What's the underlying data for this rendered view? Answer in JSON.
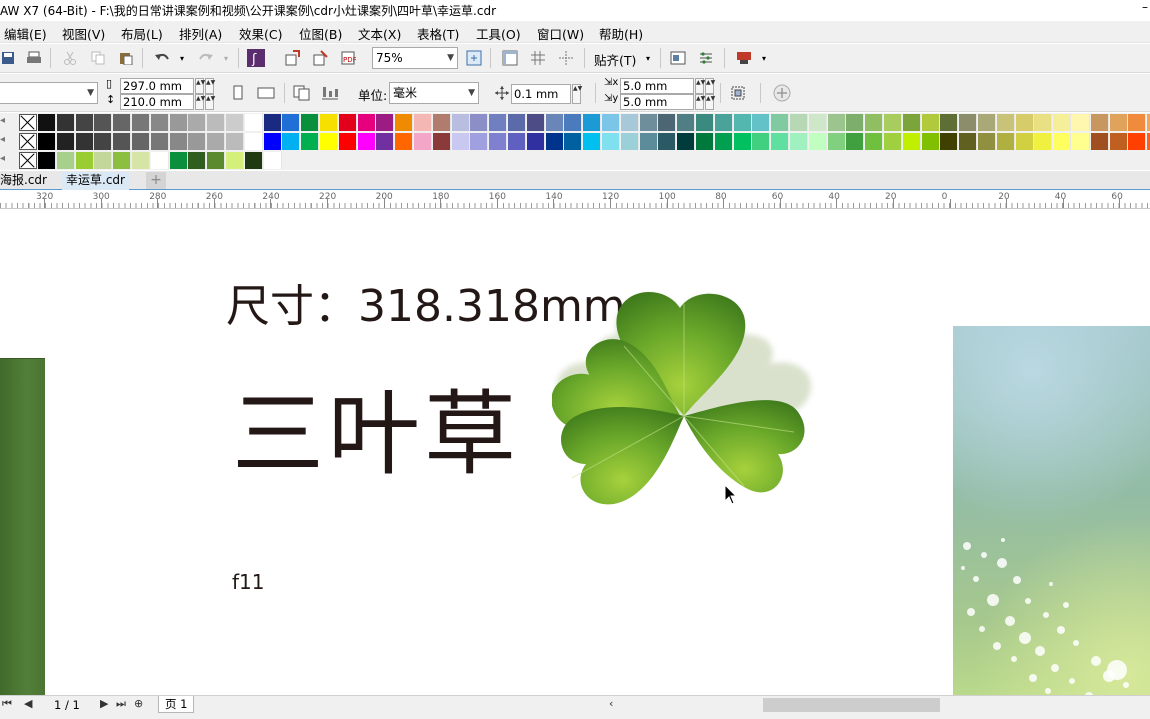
{
  "window": {
    "title": "AW X7 (64-Bit) - F:\\我的日常讲课案例和视频\\公开课案例\\cdr小灶课案列\\四叶草\\幸运草.cdr",
    "minimize": "–"
  },
  "menu": {
    "items": [
      "编辑(E)",
      "视图(V)",
      "布局(L)",
      "排列(A)",
      "效果(C)",
      "位图(B)",
      "文本(X)",
      "表格(T)",
      "工具(O)",
      "窗口(W)",
      "帮助(H)"
    ]
  },
  "toolbar": {
    "zoom": "75%",
    "snap_label": "贴齐(T)"
  },
  "property_bar": {
    "width": "297.0 mm",
    "height": "210.0 mm",
    "unit_label": "单位:",
    "unit_value": "毫米",
    "nudge": "0.1 mm",
    "dup_x": "5.0 mm",
    "dup_y": "5.0 mm"
  },
  "palette": {
    "accent": "#5b9bd5"
  },
  "tabs": {
    "items": [
      "海报.cdr",
      "幸运草.cdr"
    ],
    "active": "幸运草.cdr",
    "add": "+"
  },
  "ruler": {
    "labels": [
      "320",
      "300",
      "280",
      "260",
      "240",
      "220",
      "200",
      "180",
      "160",
      "140",
      "120",
      "100",
      "80",
      "60",
      "40",
      "20",
      "0",
      "20",
      "40",
      "60"
    ]
  },
  "canvas": {
    "size_text": "尺寸：318.318mm",
    "title": "三叶草",
    "small_label": "f11"
  },
  "status": {
    "page_count": "1 / 1",
    "page_tab": "页 1"
  }
}
